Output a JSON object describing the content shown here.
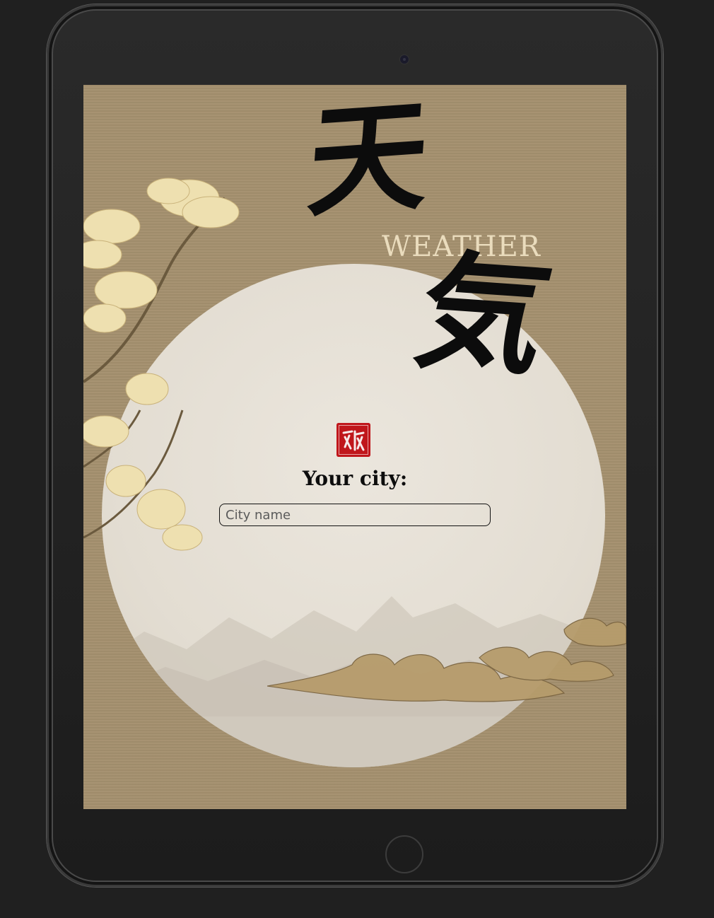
{
  "app": {
    "title_kanji_1": "天",
    "title_kanji_2": "気",
    "title_english": "WEATHER",
    "seal_glyph": "確认"
  },
  "form": {
    "city_label": "Your city:",
    "city_placeholder": "City name",
    "city_value": ""
  },
  "colors": {
    "background_paper": "#a4906e",
    "moon": "#e6e0d6",
    "seal_red": "#c0161b",
    "ink": "#0c0c0c",
    "weather_text": "#eadcbd",
    "device_bezel": "#1e1e1e"
  },
  "icons": {
    "seal": "red-stamp-seal-icon",
    "camera": "front-camera-icon",
    "home": "home-button-icon"
  }
}
